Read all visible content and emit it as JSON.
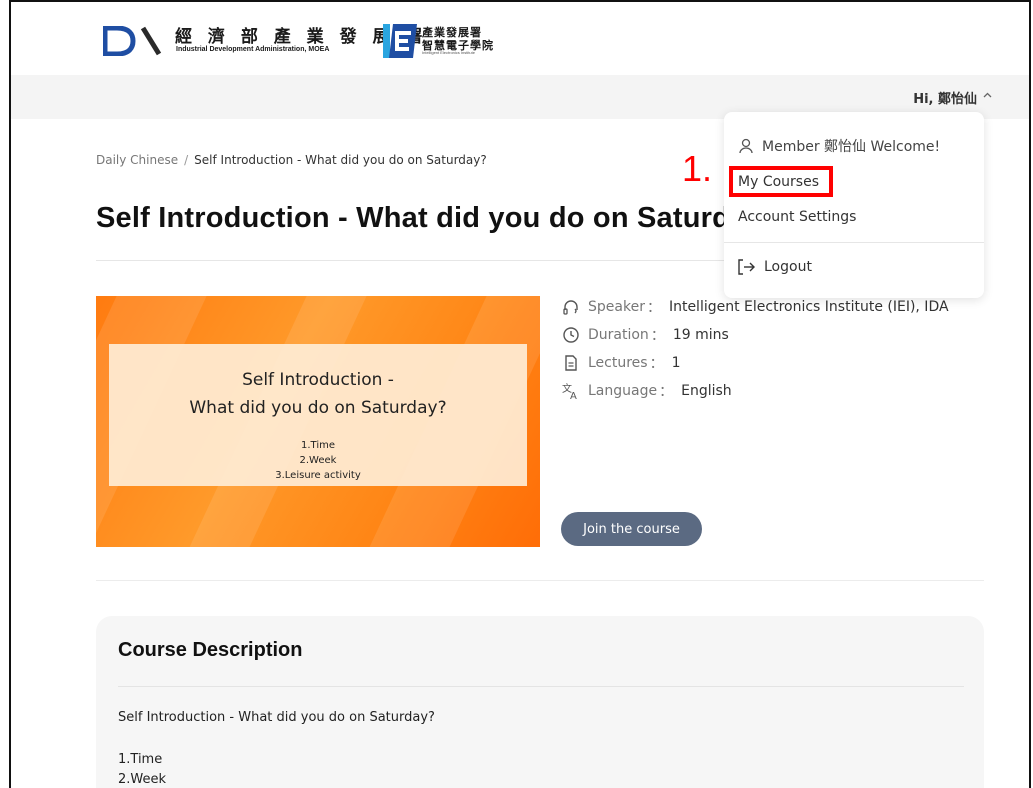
{
  "header": {
    "moea_name_cn": "經 濟 部 產 業 發 展 署",
    "moea_name_en": "Industrial Development Administration, MOEA",
    "iei_name_cn_line1": "產業發展署",
    "iei_name_cn_line2": "智慧電子學院",
    "iei_name_en": "Intelligent Electronics Institute"
  },
  "nav": {
    "greeting": "Hi, 鄭怡仙",
    "chevron": "^"
  },
  "breadcrumb": {
    "parent": "Daily Chinese",
    "separator": "/",
    "current": "Self Introduction - What did you do on Saturday?"
  },
  "course": {
    "title": "Self Introduction - What did you do on Saturday?",
    "image": {
      "title_line1": "Self Introduction -",
      "title_line2": "What did you do on Saturday?",
      "items": [
        "1.Time",
        "2.Week",
        "3.Leisure activity"
      ]
    },
    "info": {
      "speaker_label": "Speaker",
      "speaker_value": "Intelligent Electronics Institute (IEI), IDA",
      "duration_label": "Duration",
      "duration_value": "19 mins",
      "lectures_label": "Lectures",
      "lectures_value": "1",
      "language_label": "Language",
      "language_value": "English",
      "colon": "："
    },
    "join_label": "Join the course"
  },
  "description": {
    "title": "Course Description",
    "lines": [
      "Self Introduction - What did you do on Saturday?",
      "1.Time",
      "2.Week"
    ]
  },
  "dropdown": {
    "member_text": "Member 鄭怡仙 Welcome!",
    "my_courses": "My Courses",
    "account_settings": "Account Settings",
    "logout": "Logout"
  },
  "annotation": {
    "label": "1.",
    "color": "#ff0000"
  },
  "colors": {
    "accent_button": "#5b6a82",
    "brand_blue": "#1f4ea3",
    "orange": "#ff8616"
  }
}
